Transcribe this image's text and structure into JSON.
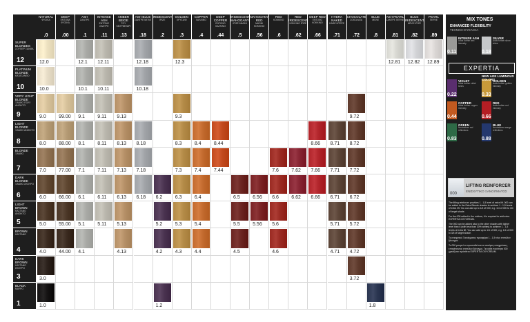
{
  "columns": [
    {
      "name": "NATURAL",
      "greek": "ΦΥΣΙΚΑ",
      "code": ".0"
    },
    {
      "name": "DEEP",
      "greek": "ΕΝΤΟΝΑ ΦΥΣΙΚΑ",
      "code": ".00"
    },
    {
      "name": "ASH",
      "greek": "ΣΑΝΤΡΕ",
      "code": ".1"
    },
    {
      "name": "INTENSE ASH",
      "greek": "ΕΝΤΟΝΟ ΣΑΝΤΡΕ",
      "code": ".11"
    },
    {
      "name": "AMBER BEIGE",
      "greek": "ΤΟΥ ΚΕΧΡΙΜΠΑΡΙ",
      "code": ".13"
    },
    {
      "name": "ASH BLUE",
      "greek": "ΣΑΝΤΡΕ ΜΠΛΕ",
      "code": ".18"
    },
    {
      "name": "IRIDESCENT",
      "greek": "ΙΡΙΖΕ",
      "code": ".2"
    },
    {
      "name": "GOLDEN",
      "greek": "ΧΡΥΣΑΦΙ",
      "code": ".3"
    },
    {
      "name": "COPPER",
      "greek": "ΧΑΛΚΙΝΟ",
      "code": ".4"
    },
    {
      "name": "DEEP COPPER",
      "greek": "ΕΝΤΟΝΟ ΧΑΛΚΙΝΟ",
      "code": ".44"
    },
    {
      "name": "IRIDESCENT MAHOGANY",
      "greek": "ΙΡΙΖΕ ΜΑΟΝΙ",
      "code": ".5"
    },
    {
      "name": "MAHOGANY RED",
      "greek": "ΜΑΟΝΙ ΚΟΚΚΙΝΟ",
      "code": ".56"
    },
    {
      "name": "RED",
      "greek": "ΚΟΚΚΙΝΟ",
      "code": ".6"
    },
    {
      "name": "RED IRIDESCENT",
      "greek": "ΚΟΚΚΙΝΟ ΙΡΙΖΕ",
      "code": ".62"
    },
    {
      "name": "DEEP RED",
      "greek": "ΕΝΤΟΝΟ ΚΟΚΚΙΝΟ",
      "code": ".66"
    },
    {
      "name": "HYBRA NAKED",
      "greek": "ΚΑΦΕ ΝΤΕΡΕ",
      "code": ".71"
    },
    {
      "name": "CHOCOLATE",
      "greek": "ΣΟΚΟΛΑΤΑ",
      "code": ".72"
    },
    {
      "name": "BLUE",
      "greek": "ΜΠΛΕ",
      "code": ".8"
    },
    {
      "name": "ASH PEARL",
      "greek": "ΣΑΝΤΡΕ ΠΕΡΛΕ",
      "code": ".81"
    },
    {
      "name": "BLUE IRIDESCENT",
      "greek": "ΜΠΛΕ ΙΡΙΖΕ",
      "code": ".82"
    },
    {
      "name": "PEARL",
      "greek": "ΠΕΡΛΕ",
      "code": ".89"
    }
  ],
  "levels": [
    {
      "name": "SUPER BLONDES",
      "greek": "ΣΟΥΠΕΡ ΞΑΝΘΑ",
      "number": "12",
      "cells": [
        [
          "12.0",
          0
        ],
        null,
        [
          "12.1",
          2
        ],
        [
          "12.11",
          3
        ],
        null,
        [
          "12.18",
          5
        ],
        null,
        [
          "12.3",
          7
        ],
        null,
        null,
        null,
        null,
        null,
        null,
        null,
        null,
        null,
        null,
        [
          "12.81",
          18
        ],
        [
          "12.82",
          19
        ],
        [
          "12.89",
          20
        ]
      ]
    },
    {
      "name": "PLATINUM BLONDE",
      "greek": "ΚΑΤΑΞΑΝΘΟ",
      "number": "10",
      "cells": [
        [
          "10.0",
          0
        ],
        null,
        [
          "10.1",
          2
        ],
        [
          "10.11",
          3
        ],
        null,
        [
          "10.18",
          5
        ],
        null,
        null,
        null,
        null,
        null,
        null,
        null,
        null,
        null,
        null,
        null,
        null,
        null,
        null,
        null
      ]
    },
    {
      "name": "VERY LIGHT BLONDE",
      "greek": "ΞΑΝΘΟ ΠΟΛΥ ΑΝΟΙΧΤΟ",
      "number": "9",
      "cells": [
        [
          "9.0",
          0
        ],
        [
          "99.00",
          1
        ],
        [
          "9.1",
          2
        ],
        [
          "9.11",
          3
        ],
        [
          "9.13",
          4
        ],
        null,
        null,
        [
          "9.3",
          7
        ],
        null,
        null,
        null,
        null,
        null,
        null,
        null,
        null,
        [
          "9.72",
          16
        ],
        null,
        null,
        null,
        null
      ]
    },
    {
      "name": "LIGHT BLONDE",
      "greek": "ΞΑΝΘΟ ΑΝΟΙΧΤΟ",
      "number": "8",
      "cells": [
        [
          "8.0",
          0
        ],
        [
          "88.00",
          1
        ],
        [
          "8.1",
          2
        ],
        [
          "8.11",
          3
        ],
        [
          "8.13",
          4
        ],
        [
          "8.18",
          5
        ],
        null,
        [
          "8.3",
          7
        ],
        [
          "8.4",
          8
        ],
        [
          "8.44",
          9
        ],
        null,
        null,
        null,
        null,
        [
          "8.66",
          14
        ],
        [
          "8.71",
          15
        ],
        [
          "8.72",
          16
        ],
        null,
        null,
        null,
        null
      ]
    },
    {
      "name": "BLONDE",
      "greek": "ΞΑΝΘΟ",
      "number": "7",
      "cells": [
        [
          "7.0",
          0
        ],
        [
          "77.00",
          1
        ],
        [
          "7.1",
          2
        ],
        [
          "7.11",
          3
        ],
        [
          "7.13",
          4
        ],
        [
          "7.18",
          5
        ],
        null,
        [
          "7.3",
          7
        ],
        [
          "7.4",
          8
        ],
        [
          "7.44",
          9
        ],
        null,
        null,
        [
          "7.6",
          12
        ],
        [
          "7.62",
          13
        ],
        [
          "7.66",
          14
        ],
        [
          "7.71",
          15
        ],
        [
          "7.72",
          16
        ],
        null,
        null,
        null,
        null
      ]
    },
    {
      "name": "DARK BLONDE",
      "greek": "ΞΑΝΘΟ ΣΚΟΥΡΟ",
      "number": "6",
      "cells": [
        [
          "6.0",
          0
        ],
        [
          "66.00",
          1
        ],
        [
          "6.1",
          2
        ],
        [
          "6.11",
          3
        ],
        [
          "6.13",
          4
        ],
        [
          "6.18",
          5
        ],
        [
          "6.2",
          6
        ],
        [
          "6.3",
          7
        ],
        [
          "6.4",
          8
        ],
        null,
        [
          "6.5",
          10
        ],
        [
          "6.56",
          11
        ],
        [
          "6.6",
          12
        ],
        [
          "6.62",
          13
        ],
        [
          "6.66",
          14
        ],
        [
          "6.71",
          15
        ],
        [
          "6.72",
          16
        ],
        null,
        null,
        null,
        null
      ]
    },
    {
      "name": "LIGHT BROWN",
      "greek": "ΚΑΣΤΑΝΟ ΑΝΟΙΧΤΟ",
      "number": "5",
      "cells": [
        [
          "5.0",
          0
        ],
        [
          "55.00",
          1
        ],
        [
          "5.1",
          2
        ],
        [
          "5.11",
          3
        ],
        [
          "5.13",
          4
        ],
        null,
        [
          "5.2",
          6
        ],
        [
          "5.3",
          7
        ],
        [
          "5.4",
          8
        ],
        null,
        [
          "5.5",
          10
        ],
        [
          "5.56",
          11
        ],
        [
          "5.6",
          12
        ],
        null,
        null,
        [
          "5.71",
          15
        ],
        [
          "5.72",
          16
        ],
        null,
        null,
        null,
        null
      ]
    },
    {
      "name": "BROWN",
      "greek": "ΚΑΣΤΑΝΟ",
      "number": "4",
      "cells": [
        [
          "4.0",
          0
        ],
        [
          "44.00",
          1
        ],
        [
          "4.1",
          2
        ],
        null,
        [
          "4.13",
          4
        ],
        null,
        [
          "4.2",
          6
        ],
        [
          "4.3",
          7
        ],
        [
          "4.4",
          8
        ],
        null,
        [
          "4.5",
          10
        ],
        null,
        [
          "4.6",
          12
        ],
        null,
        null,
        [
          "4.71",
          15
        ],
        [
          "4.72",
          16
        ],
        null,
        null,
        null,
        null
      ]
    },
    {
      "name": "DARK BROWN",
      "greek": "ΚΑΣΤΑΝΟ ΣΚΟΥΡΟ",
      "number": "3",
      "cells": [
        [
          "3.0",
          0
        ],
        null,
        null,
        null,
        null,
        null,
        null,
        null,
        null,
        null,
        null,
        null,
        null,
        null,
        null,
        null,
        [
          "3.72",
          16
        ],
        null,
        null,
        null,
        null
      ]
    },
    {
      "name": "BLACK",
      "greek": "ΜΑΥΡΟ",
      "number": "1",
      "cells": [
        [
          "1.0",
          0
        ],
        null,
        null,
        null,
        null,
        null,
        [
          "1.2",
          6
        ],
        null,
        null,
        null,
        null,
        null,
        null,
        null,
        null,
        null,
        null,
        [
          "1.8",
          17
        ],
        null,
        null,
        null
      ]
    }
  ],
  "colors": {
    "12": "#ece0bf",
    "10": "#e6dcc6",
    "9": "#d6c19a",
    "8": "#b49a74",
    "7": "#8e7152",
    "6": "#5f4731",
    "5": "#4a3626",
    "4": "#3a2a1f",
    "3": "#2a201a",
    "1": "#141212"
  },
  "tones": {
    "0": null,
    "1": null,
    "2": "#a9aaa6",
    "3": "#b9b6ac",
    "4": "#b48f66",
    "5": "#a0a3a7",
    "6": "#4a3350",
    "7": "#b38a47",
    "8": "#c26a2e",
    "9": "#c24a1e",
    "10": "#6a2420",
    "11": "#7a2224",
    "12": "#9a2a22",
    "13": "#862432",
    "14": "#b0242a",
    "15": "#5b4437",
    "16": "#5e3a2c",
    "17": "#2a3550",
    "18": "#d6d6d0",
    "19": "#d2d3d6",
    "20": "#d9d5d3"
  },
  "panel": {
    "title": "MIX TONES",
    "subtitle": "ENHANCED FLEXIBILITY",
    "subtitle_greek": "ΤΕΧΝΙΚΗ ΕΥΕΛΙΞΙΑ",
    "brand": "EXPERTIA",
    "new_age": "NEW AGE LUMINOUS COLORS",
    "mixes": [
      {
        "name": "INTENSE ASH",
        "desc": "Adds further ash intensity",
        "code": "0.11",
        "color": "#9a9a98"
      },
      {
        "name": "SILVER",
        "desc": "Adds further silver shine",
        "code": "0.18",
        "color": "#c6c8ca"
      },
      {
        "name": "VIOLET",
        "desc": "Adds further violet tones",
        "code": "0.22",
        "color": "#5a2e6e"
      },
      {
        "name": "GOLDEN",
        "desc": "Adds further golden intensity",
        "code": "0.33",
        "color": "#c89a3a"
      },
      {
        "name": "COPPER",
        "desc": "Adds further copper intensity",
        "code": "0.44",
        "color": "#c25a20"
      },
      {
        "name": "RED",
        "desc": "Adds further red intensity",
        "code": "0.66",
        "color": "#b41e24"
      },
      {
        "name": "GREEN",
        "desc": "Neutralizes red reflections",
        "code": "0.83",
        "color": "#2e6a46"
      },
      {
        "name": "BLUE",
        "desc": "Neutralizes orange reflections",
        "code": "0.88",
        "color": "#24386e"
      }
    ],
    "ash_entonos": "ΕΝΤΟΝΟ ΣΑΝΤΡΕ",
    "lifting_code": "000",
    "lifting_title": "LIFTING REINFORCER",
    "lifting_greek": "ΕΝΙΣΧΥΤΙΚΟ ΞΑΝΟΙΓΜΑΤΟΣ",
    "lifting_p1": "The lifting reinforcer provides 1 - 1,5 level of extra lift. 000 can be added to the Extra Blonde shades to achieve 1 - 1,5 levels of extra lift. You can add up to 1/4 of 000, e.g. 1/4 of 000 to 3/4 of target shade.",
    "lifting_p2": "For the 000 added in the mixture, it is required to add extra EXPERTIA OXYCREAM.",
    "lifting_p3": "The 000 can be added also to the other shades with lighter level than 6 (with less than 30% whites) to achieve 1 - 1,5 levels of extra lift. You can add up to 1/4 of 000, e.g. 1/4 of 000 to 3/4 of target shade.",
    "lifting_p4": "Το ενισχυτικό Ξανοίγματος προσφέρει 1 - 1,5 τόνο επιπλέον ξάνοιγμα.",
    "lifting_p5": "Το 000 μπορεί να προστεθεί και σε σκούρες αποχρώσεις, επιτρέποντας επιπλέον ξάνοιγμα. Για κάθε ποσότητα 000 χρειάζεται πρόσθετο EXPERTIA OXYCREAM."
  }
}
